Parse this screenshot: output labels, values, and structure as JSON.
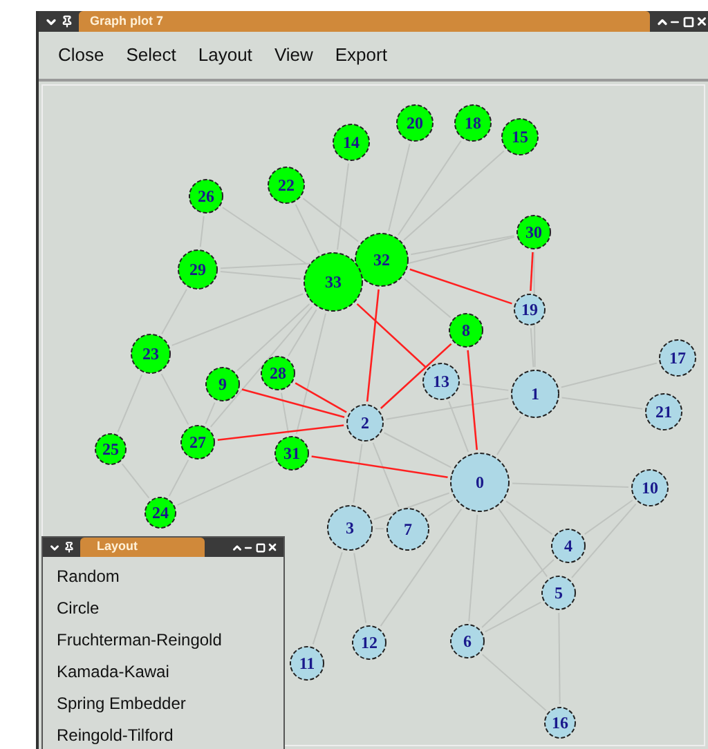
{
  "window": {
    "title": "Graph plot 7"
  },
  "menu": [
    "Close",
    "Select",
    "Layout",
    "View",
    "Export"
  ],
  "nodes": [
    {
      "label": "14",
      "color": "#00ff00"
    },
    {
      "label": "20",
      "color": "#00ff00"
    },
    {
      "label": "18",
      "color": "#00ff00"
    },
    {
      "label": "15",
      "color": "#00ff00"
    },
    {
      "label": "22",
      "color": "#00ff00"
    },
    {
      "label": "26",
      "color": "#00ff00"
    },
    {
      "label": "30",
      "color": "#00ff00"
    },
    {
      "label": "32",
      "color": "#00ff00"
    },
    {
      "label": "33",
      "color": "#00ff00"
    },
    {
      "label": "29",
      "color": "#00ff00"
    },
    {
      "label": "19",
      "color": "#add8e6"
    },
    {
      "label": "8",
      "color": "#00ff00"
    },
    {
      "label": "23",
      "color": "#00ff00"
    },
    {
      "label": "17",
      "color": "#add8e6"
    },
    {
      "label": "9",
      "color": "#00ff00"
    },
    {
      "label": "28",
      "color": "#00ff00"
    },
    {
      "label": "13",
      "color": "#add8e6"
    },
    {
      "label": "1",
      "color": "#add8e6"
    },
    {
      "label": "21",
      "color": "#add8e6"
    },
    {
      "label": "2",
      "color": "#add8e6"
    },
    {
      "label": "25",
      "color": "#00ff00"
    },
    {
      "label": "27",
      "color": "#00ff00"
    },
    {
      "label": "31",
      "color": "#00ff00"
    },
    {
      "label": "0",
      "color": "#add8e6"
    },
    {
      "label": "10",
      "color": "#add8e6"
    },
    {
      "label": "24",
      "color": "#00ff00"
    },
    {
      "label": "3",
      "color": "#add8e6"
    },
    {
      "label": "7",
      "color": "#add8e6"
    },
    {
      "label": "4",
      "color": "#add8e6"
    },
    {
      "label": "5",
      "color": "#add8e6"
    },
    {
      "label": "11",
      "color": "#add8e6"
    },
    {
      "label": "12",
      "color": "#add8e6"
    },
    {
      "label": "6",
      "color": "#add8e6"
    },
    {
      "label": "16",
      "color": "#add8e6"
    }
  ],
  "layout_window": {
    "title": "Layout",
    "items": [
      "Random",
      "Circle",
      "Fruchterman-Reingold",
      "Kamada-Kawai",
      "Spring Embedder",
      "Reingold-Tilford"
    ]
  }
}
